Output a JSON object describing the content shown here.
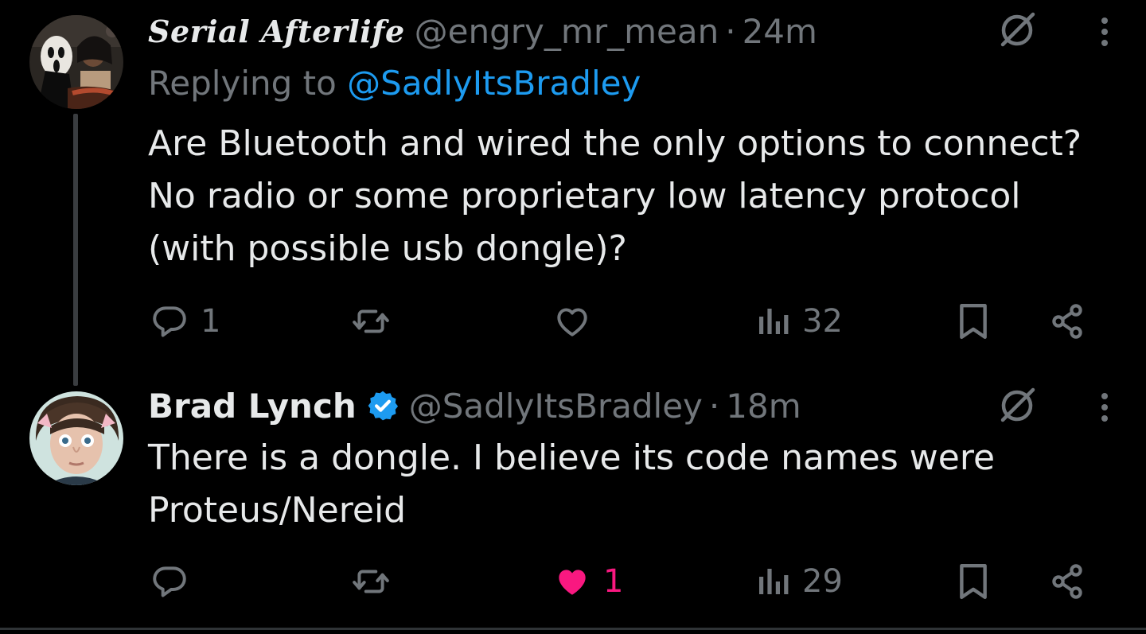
{
  "thread": [
    {
      "display_name": "Serial Afterlife",
      "handle": "@engry_mr_mean",
      "separator": "·",
      "time": "24m",
      "reply_prefix": "Replying to",
      "reply_mention": "@SadlyItsBradley",
      "text": "Are Bluetooth and wired the only options to connect? No radio or some proprietary low latency protocol (with possible usb dongle)?",
      "counts": {
        "replies": "1",
        "retweets": "",
        "likes": "",
        "views": "32"
      },
      "liked": false,
      "verified": false,
      "icons": [
        "grok-icon",
        "more-icon",
        "reply-icon",
        "retweet-icon",
        "heart-icon",
        "views-icon",
        "bookmark-icon",
        "share-icon"
      ]
    },
    {
      "display_name": "Brad Lynch",
      "handle": "@SadlyItsBradley",
      "separator": "·",
      "time": "18m",
      "text": "There is a dongle. I believe its code names were Proteus/Nereid",
      "counts": {
        "replies": "",
        "retweets": "",
        "likes": "1",
        "views": "29"
      },
      "liked": true,
      "verified": true,
      "icons": [
        "verified-badge-icon",
        "grok-icon",
        "more-icon",
        "reply-icon",
        "retweet-icon",
        "heart-filled-icon",
        "views-icon",
        "bookmark-icon",
        "share-icon"
      ]
    }
  ],
  "colors": {
    "background": "#000000",
    "text": "#e7e9ea",
    "muted": "#71767b",
    "accent": "#1d9bf0",
    "like": "#f91880",
    "thread_line": "#3a3d40"
  }
}
